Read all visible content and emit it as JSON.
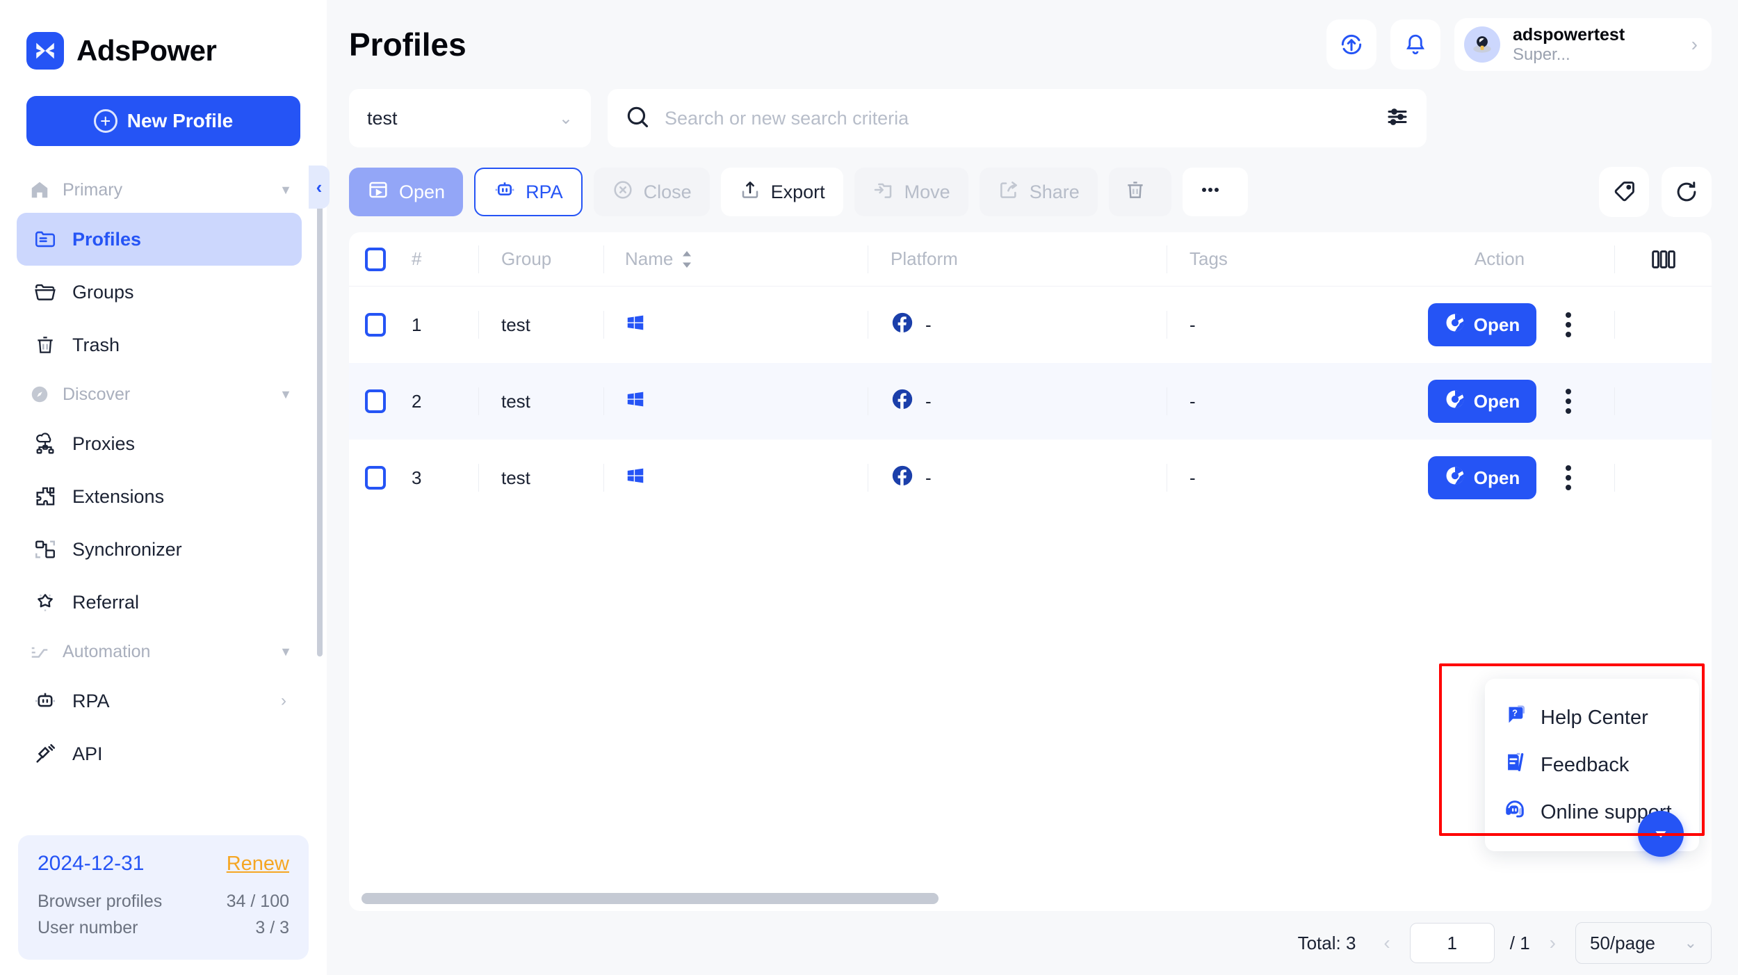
{
  "brand": {
    "name": "AdsPower",
    "logo_icon": "adspower-logo-icon"
  },
  "sidebar": {
    "new_profile_label": "New Profile",
    "groups": [
      {
        "label": "Primary",
        "icon": "home-icon",
        "items": [
          {
            "label": "Profiles",
            "icon": "folder-list-icon",
            "active": true
          },
          {
            "label": "Groups",
            "icon": "folder-icon",
            "active": false
          },
          {
            "label": "Trash",
            "icon": "trash-icon",
            "active": false
          }
        ]
      },
      {
        "label": "Discover",
        "icon": "compass-icon",
        "items": [
          {
            "label": "Proxies",
            "icon": "proxy-cloud-icon",
            "active": false
          },
          {
            "label": "Extensions",
            "icon": "puzzle-icon",
            "active": false
          },
          {
            "label": "Synchronizer",
            "icon": "synchronizer-icon",
            "active": false
          },
          {
            "label": "Referral",
            "icon": "star-icon",
            "active": false
          }
        ]
      },
      {
        "label": "Automation",
        "icon": "automation-icon",
        "items": [
          {
            "label": "RPA",
            "icon": "robot-icon",
            "active": false,
            "has_submenu": true
          },
          {
            "label": "API",
            "icon": "api-plug-icon",
            "active": false
          }
        ]
      }
    ],
    "subscription": {
      "expiry_date": "2024-12-31",
      "renew_label": "Renew",
      "rows": [
        {
          "label": "Browser profiles",
          "value": "34 / 100"
        },
        {
          "label": "User number",
          "value": "3 / 3"
        }
      ]
    },
    "collapse_icon": "chevron-left-icon"
  },
  "header": {
    "title": "Profiles",
    "sync_icon": "sync-upload-icon",
    "bell_icon": "bell-icon",
    "account": {
      "name": "adspowertest",
      "role": "Super...",
      "avatar_icon": "astronaut-avatar-icon",
      "chevron_icon": "chevron-right-icon"
    }
  },
  "search": {
    "group_value": "test",
    "group_chevron_icon": "chevron-down-icon",
    "placeholder": "Search or new search criteria",
    "value": "",
    "search_icon": "search-icon",
    "filter_icon": "filter-sliders-icon"
  },
  "toolbar": {
    "buttons": [
      {
        "label": "Open",
        "icon": "window-open-icon",
        "style": "primary"
      },
      {
        "label": "RPA",
        "icon": "robot-icon",
        "style": "outlined"
      },
      {
        "label": "Close",
        "icon": "close-circle-icon",
        "style": "disabled"
      },
      {
        "label": "Export",
        "icon": "export-upload-icon",
        "style": "normal"
      },
      {
        "label": "Move",
        "icon": "move-folder-icon",
        "style": "disabled"
      },
      {
        "label": "Share",
        "icon": "share-icon",
        "style": "disabled"
      },
      {
        "label": "",
        "icon": "trash-icon",
        "style": "disabled"
      },
      {
        "label": "",
        "icon": "more-dots-icon",
        "style": "normal"
      }
    ],
    "right_buttons": [
      {
        "icon": "tag-icon"
      },
      {
        "icon": "refresh-icon"
      }
    ]
  },
  "table": {
    "columns": [
      {
        "key": "check",
        "label": "",
        "icon": "checkbox-icon"
      },
      {
        "key": "num",
        "label": "#"
      },
      {
        "key": "group",
        "label": "Group"
      },
      {
        "key": "name",
        "label": "Name",
        "sortable": true,
        "icon": "sort-icon"
      },
      {
        "key": "platform",
        "label": "Platform"
      },
      {
        "key": "tags",
        "label": "Tags"
      },
      {
        "key": "action",
        "label": "Action"
      },
      {
        "key": "columns",
        "label": "",
        "icon": "column-settings-icon"
      }
    ],
    "rows": [
      {
        "num": "1",
        "group": "test",
        "name": "",
        "os_icon": "windows-icon",
        "platform_icon": "facebook-icon",
        "platform": "-",
        "tags": "-",
        "action_label": "Open",
        "action_icon": "chrome-icon",
        "kebab_icon": "kebab-menu-icon",
        "highlight": false
      },
      {
        "num": "2",
        "group": "test",
        "name": "",
        "os_icon": "windows-icon",
        "platform_icon": "facebook-icon",
        "platform": "-",
        "tags": "-",
        "action_label": "Open",
        "action_icon": "chrome-icon",
        "kebab_icon": "kebab-menu-icon",
        "highlight": true
      },
      {
        "num": "3",
        "group": "test",
        "name": "",
        "os_icon": "windows-icon",
        "platform_icon": "facebook-icon",
        "platform": "-",
        "tags": "-",
        "action_label": "Open",
        "action_icon": "chrome-icon",
        "kebab_icon": "kebab-menu-icon",
        "highlight": false
      }
    ]
  },
  "help_popup": {
    "highlight_color": "#ff0000",
    "items": [
      {
        "label": "Help Center",
        "icon": "help-question-icon"
      },
      {
        "label": "Feedback",
        "icon": "feedback-icon"
      },
      {
        "label": "Online support",
        "icon": "headset-icon"
      }
    ],
    "fab_icon": "chevron-down-icon"
  },
  "pagination": {
    "total_label": "Total: 3",
    "prev_icon": "chevron-left-icon",
    "next_icon": "chevron-right-icon",
    "current_page": "1",
    "page_of": "/ 1",
    "page_size": "50/page",
    "page_size_chevron_icon": "chevron-down-icon"
  },
  "colors": {
    "accent": "#2554f5",
    "accent_soft": "#93a6f7",
    "renew": "#f5a623",
    "highlight": "#ff0000"
  }
}
